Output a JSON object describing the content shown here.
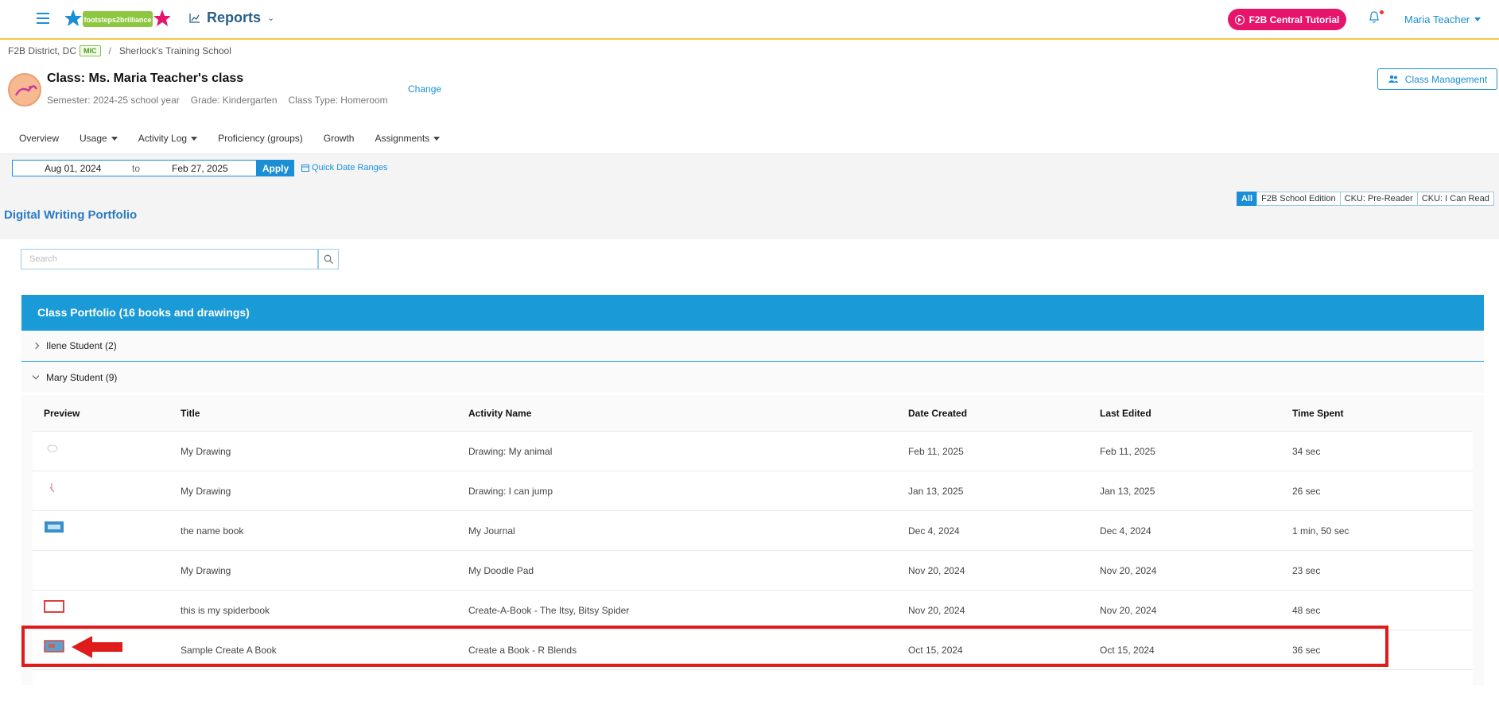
{
  "header": {
    "logo_text": "footsteps2brilliance",
    "reports_label": "Reports",
    "tutorial_label": "F2B Central Tutorial",
    "user_name": "Maria Teacher"
  },
  "breadcrumb": {
    "district": "F2B District, DC",
    "badge": "MIC",
    "separator": "/",
    "school": "Sherlock's Training School"
  },
  "class_info": {
    "title": "Class: Ms. Maria Teacher's class",
    "semester": "Semester: 2024-25 school year",
    "grade": "Grade: Kindergarten",
    "class_type": "Class Type: Homeroom",
    "change_label": "Change",
    "management_label": "Class Management"
  },
  "nav": {
    "overview": "Overview",
    "usage": "Usage",
    "activity_log": "Activity Log",
    "proficiency": "Proficiency (groups)",
    "growth": "Growth",
    "assignments": "Assignments"
  },
  "date_range": {
    "start": "Aug 01, 2024",
    "to": "to",
    "end": "Feb 27, 2025",
    "apply_label": "Apply",
    "quick_label": "Quick Date Ranges"
  },
  "section_title": "Digital Writing Portfolio",
  "filters": [
    "All",
    "F2B School Edition",
    "CKU: Pre-Reader",
    "CKU: I Can Read"
  ],
  "search": {
    "placeholder": "Search"
  },
  "portfolio": {
    "header": "Class Portfolio (16 books and drawings)",
    "students": [
      {
        "name": "Ilene Student (2)"
      },
      {
        "name": "Mary Student (9)"
      }
    ],
    "columns": {
      "preview": "Preview",
      "title": "Title",
      "activity": "Activity Name",
      "created": "Date Created",
      "edited": "Last Edited",
      "time": "Time Spent"
    },
    "rows": [
      {
        "title": "My Drawing",
        "activity": "Drawing: My animal",
        "created": "Feb 11, 2025",
        "edited": "Feb 11, 2025",
        "time": "34 sec"
      },
      {
        "title": "My Drawing",
        "activity": "Drawing: I can jump",
        "created": "Jan 13, 2025",
        "edited": "Jan 13, 2025",
        "time": "26 sec"
      },
      {
        "title": "the name book",
        "activity": "My Journal",
        "created": "Dec 4, 2024",
        "edited": "Dec 4, 2024",
        "time": "1 min, 50 sec"
      },
      {
        "title": "My Drawing",
        "activity": "My Doodle Pad",
        "created": "Nov 20, 2024",
        "edited": "Nov 20, 2024",
        "time": "23 sec"
      },
      {
        "title": "this is my spiderbook",
        "activity": "Create-A-Book - The Itsy, Bitsy Spider",
        "created": "Nov 20, 2024",
        "edited": "Nov 20, 2024",
        "time": "48 sec"
      },
      {
        "title": "Sample Create A Book",
        "activity": "Create a Book - R Blends",
        "created": "Oct 15, 2024",
        "edited": "Oct 15, 2024",
        "time": "36 sec"
      }
    ]
  },
  "colors": {
    "accent": "#1a8fd6",
    "portfolio_header": "#1a9ad6",
    "tutorial": "#e6156b",
    "highlight": "#e01b1b"
  }
}
